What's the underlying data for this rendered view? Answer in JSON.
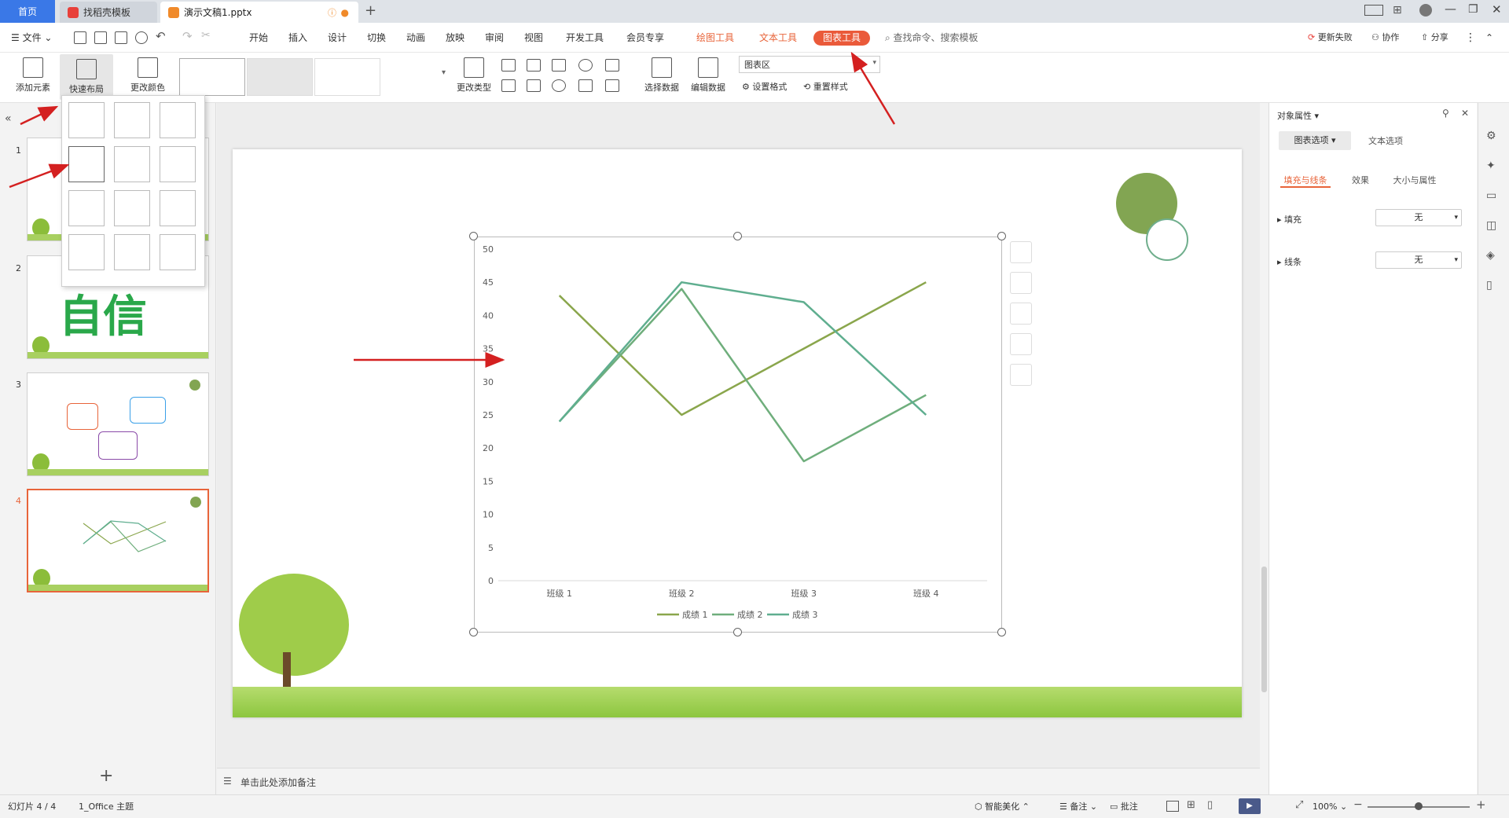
{
  "tabs": {
    "home": "首页",
    "template": "找稻壳模板",
    "doc": "演示文稿1.pptx"
  },
  "menu": {
    "file": "文件",
    "items": [
      "开始",
      "插入",
      "设计",
      "切换",
      "动画",
      "放映",
      "审阅",
      "视图",
      "开发工具",
      "会员专享"
    ],
    "drawing_tools": "绘图工具",
    "text_tools": "文本工具",
    "chart_tools": "图表工具",
    "search": "查找命令、搜索模板",
    "update_failed": "更新失败",
    "collaborate": "协作",
    "share": "分享"
  },
  "ribbon": {
    "add_element": "添加元素",
    "quick_layout": "快速布局",
    "change_color": "更改颜色",
    "change_type": "更改类型",
    "select_data": "选择数据",
    "edit_data": "编辑数据",
    "chart_area": "图表区",
    "set_format": "设置格式",
    "reset_style": "重置样式"
  },
  "slides": [
    {
      "num": "1"
    },
    {
      "num": "2",
      "big_text": "自信"
    },
    {
      "num": "3"
    },
    {
      "num": "4"
    }
  ],
  "chart_data": {
    "type": "line",
    "categories": [
      "班级 1",
      "班级 2",
      "班级 3",
      "班级 4"
    ],
    "ylim": [
      0,
      50
    ],
    "yticks": [
      0,
      5,
      10,
      15,
      20,
      25,
      30,
      35,
      40,
      45,
      50
    ],
    "series": [
      {
        "name": "成绩 1",
        "values": [
          43,
          25,
          35,
          45
        ],
        "color": "#8aa64c"
      },
      {
        "name": "成绩 2",
        "values": [
          24,
          44,
          18,
          28
        ],
        "color": "#6fae7c"
      },
      {
        "name": "成绩 3",
        "values": [
          24,
          45,
          42,
          25
        ],
        "color": "#5fae8f"
      }
    ],
    "legend": "bottom",
    "grid": false
  },
  "notes_placeholder": "单击此处添加备注",
  "right_panel": {
    "title": "对象属性",
    "tab_chart": "图表选项",
    "tab_text": "文本选项",
    "sub_fill_line": "填充与线条",
    "sub_effect": "效果",
    "sub_size": "大小与属性",
    "fill_label": "填充",
    "fill_value": "无",
    "line_label": "线条",
    "line_value": "无"
  },
  "status": {
    "slide_count": "幻灯片 4 / 4",
    "theme": "1_Office 主题",
    "smart_beautify": "智能美化",
    "notes": "备注",
    "comments": "批注",
    "zoom": "100%"
  },
  "colors": {
    "accent": "#ea5a3a",
    "home_tab": "#3a78e7",
    "circle": "#82a552"
  }
}
